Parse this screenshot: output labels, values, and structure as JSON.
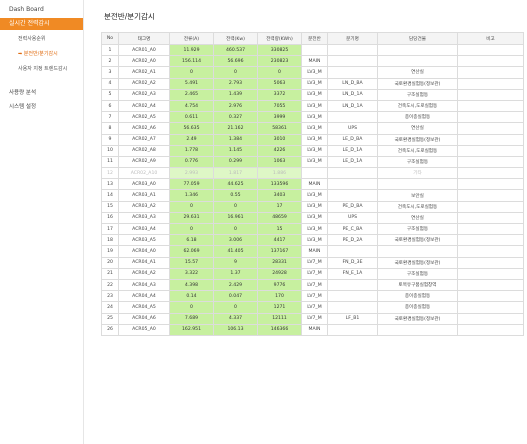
{
  "sidebar": {
    "dashboard": "Dash Board",
    "active_menu": "실시간 전력감시",
    "sub_items": [
      "전력사용순위",
      "분전반/분기감시",
      "사용자 지정 트렌드감시"
    ],
    "menus": [
      "사용량 분석",
      "시스템 설정"
    ]
  },
  "page_title": "분전반/분기감시",
  "table": {
    "headers": [
      "No",
      "태그명",
      "전류(A)",
      "전력(Kw)",
      "전력량(KWh)",
      "분전반",
      "분기명",
      "담당건물",
      "비고"
    ],
    "rows": [
      [
        "1",
        "ACR01_A0",
        "11.929",
        "460.537",
        "330825",
        "",
        "",
        "",
        ""
      ],
      [
        "2",
        "ACR02_A0",
        "156.114",
        "56.696",
        "230823",
        "MAIN",
        "",
        "",
        ""
      ],
      [
        "3",
        "ACR02_A1",
        "0",
        "0",
        "0",
        "LV3_M",
        "",
        "연산실",
        ""
      ],
      [
        "4",
        "ACR02_A2",
        "5.491",
        "2.793",
        "5063",
        "LV3_M",
        "LN_D_BA",
        "국토환경실험동(정보관)",
        ""
      ],
      [
        "5",
        "ACR02_A3",
        "2.465",
        "1.439",
        "3372",
        "LV3_M",
        "LN_D_1A",
        "구조실험동",
        ""
      ],
      [
        "6",
        "ACR02_A4",
        "4.754",
        "2.976",
        "7055",
        "LV3_M",
        "LN_D_1A",
        "건축도시,도로실험동",
        ""
      ],
      [
        "7",
        "ACR02_A5",
        "0.611",
        "0.327",
        "3999",
        "LV3_M",
        "",
        "종이종실험동",
        ""
      ],
      [
        "8",
        "ACR02_A6",
        "56.635",
        "21.162",
        "58361",
        "LV3_M",
        "UPS",
        "연산실",
        ""
      ],
      [
        "9",
        "ACR02_A7",
        "2.49",
        "1.384",
        "3010",
        "LV3_M",
        "LE_D_BA",
        "국토환경실험동(정보관)",
        ""
      ],
      [
        "10",
        "ACR02_A8",
        "1.778",
        "1.145",
        "4226",
        "LV3_M",
        "LE_D_1A",
        "건축도시,도로실험동",
        ""
      ],
      [
        "11",
        "ACR02_A9",
        "0.776",
        "0.299",
        "1063",
        "LV3_M",
        "LE_D_1A",
        "구조실험동",
        ""
      ],
      [
        "12",
        "ACR02_A10",
        "2.993",
        "1.817",
        "1.886",
        "",
        "",
        "기타",
        ""
      ],
      [
        "13",
        "ACR03_A0",
        "77.059",
        "44.625",
        "133596",
        "MAIN",
        "",
        "",
        ""
      ],
      [
        "14",
        "ACR03_A1",
        "1.346",
        "0.55",
        "3403",
        "LV3_M",
        "",
        "보안실",
        ""
      ],
      [
        "15",
        "ACR03_A2",
        "0",
        "0",
        "17",
        "LV3_M",
        "PE_D_BA",
        "건축도시,도로실험동",
        ""
      ],
      [
        "16",
        "ACR03_A3",
        "29.631",
        "16.961",
        "48659",
        "LV3_M",
        "UPS",
        "연산실",
        ""
      ],
      [
        "17",
        "ACR03_A4",
        "0",
        "0",
        "15",
        "LV3_M",
        "PE_C_BA",
        "구조실험동",
        ""
      ],
      [
        "18",
        "ACR03_A5",
        "6.18",
        "3.006",
        "4417",
        "LV3_M",
        "PE_D_2A",
        "국토환경실험동(정보관)",
        ""
      ],
      [
        "19",
        "ACR04_A0",
        "62.069",
        "41.405",
        "137167",
        "MAIN",
        "",
        "",
        ""
      ],
      [
        "20",
        "ACR04_A1",
        "15.57",
        "9",
        "28331",
        "LV7_M",
        "FN_D_3E",
        "국토환경실험동(정보관)",
        ""
      ],
      [
        "21",
        "ACR04_A2",
        "3.322",
        "1.37",
        "24928",
        "LV7_M",
        "FN_E_1A",
        "구조실험동",
        ""
      ],
      [
        "22",
        "ACR04_A3",
        "4.398",
        "2.429",
        "9776",
        "LV7_M",
        "",
        "토목유구품실험창역",
        ""
      ],
      [
        "23",
        "ACR04_A4",
        "0.14",
        "0.047",
        "170",
        "LV7_M",
        "",
        "종이종실험동",
        ""
      ],
      [
        "24",
        "ACR04_A5",
        "0",
        "0",
        "1271",
        "LV7_M",
        "",
        "종이종실험동",
        ""
      ],
      [
        "25",
        "ACR04_A6",
        "7.689",
        "4.337",
        "12111",
        "LV7_M",
        "LF_B1",
        "국토환경실험동(정보관)",
        ""
      ],
      [
        "26",
        "ACR05_A0",
        "162.951",
        "106.13",
        "146366",
        "MAIN",
        "",
        "",
        ""
      ]
    ],
    "faded_row_index": 11
  }
}
